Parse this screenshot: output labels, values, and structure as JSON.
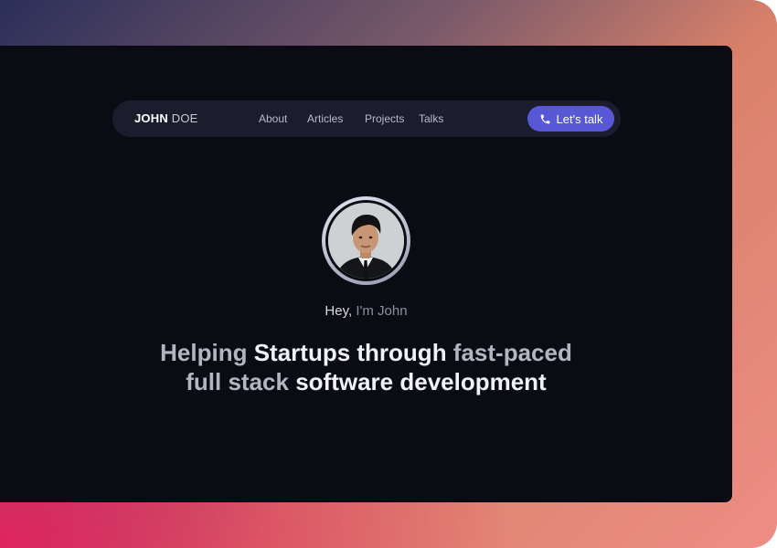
{
  "brand": {
    "first": "JOHN",
    "last": "DOE"
  },
  "nav": {
    "links": [
      "About",
      "Articles",
      "Projects",
      "Talks"
    ],
    "cta_label": "Let's talk"
  },
  "hero": {
    "greeting_lead": "Hey,",
    "greeting_rest": "I'm John",
    "headline_line1": [
      {
        "text": "Helping ",
        "style": "muted"
      },
      {
        "text": "Startups through ",
        "style": "bright"
      },
      {
        "text": "fast-paced",
        "style": "muted"
      }
    ],
    "headline_line2": [
      {
        "text": "full stack ",
        "style": "muted"
      },
      {
        "text": "software development",
        "style": "bright"
      }
    ]
  },
  "colors": {
    "accent": "#5858d6",
    "window_bg": "#0b0c13",
    "nav_bg": "#1b1d2c"
  }
}
